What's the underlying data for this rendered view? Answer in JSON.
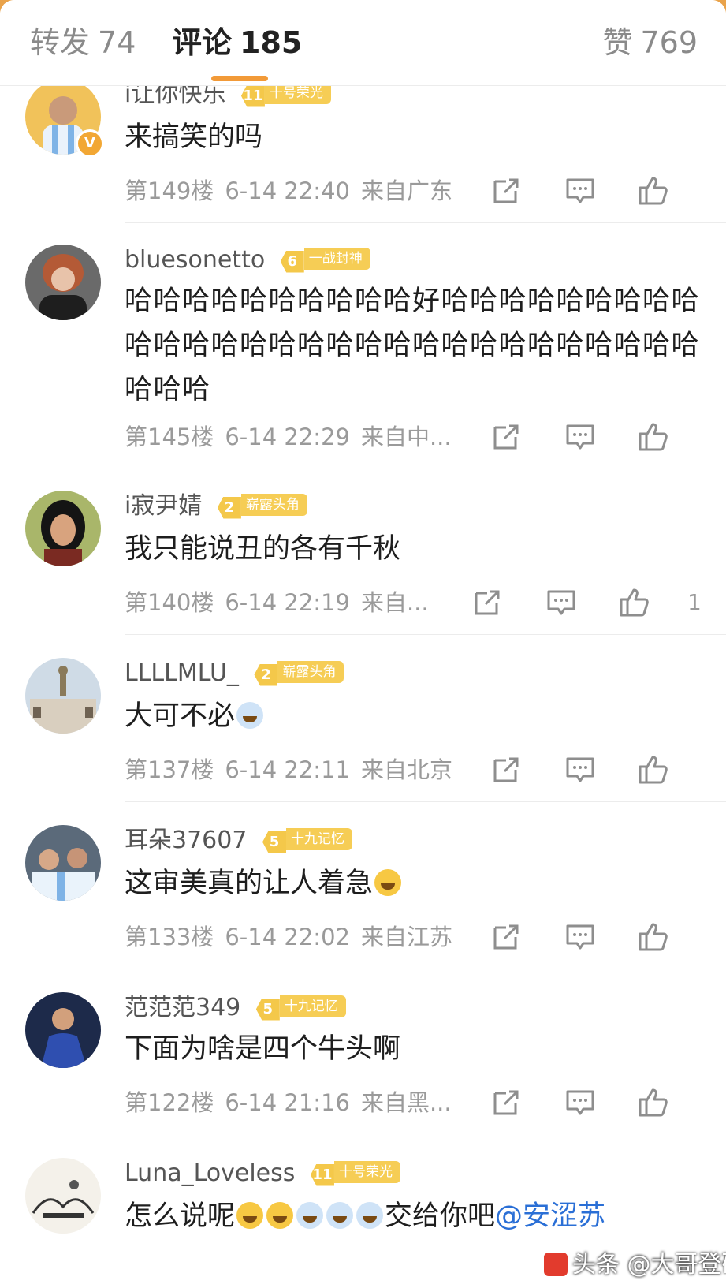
{
  "tabs": {
    "repost": {
      "label": "转发",
      "count": "74"
    },
    "comment": {
      "label": "评论",
      "count": "185"
    },
    "like": {
      "label": "赞",
      "count": "769"
    }
  },
  "comments": [
    {
      "user": "i让你快乐",
      "level": "11",
      "title": "十号荣光",
      "text": "来搞笑的吗",
      "floor": "第149楼",
      "time": "6-14 22:40",
      "location": "来自广东",
      "likes": "",
      "verified": true
    },
    {
      "user": "bluesonetto",
      "level": "6",
      "title": "一战封神",
      "text": "哈哈哈哈哈哈哈哈哈哈好哈哈哈哈哈哈哈哈哈哈哈哈哈哈哈哈哈哈哈哈哈哈哈哈哈哈哈哈哈哈哈哈",
      "floor": "第145楼",
      "time": "6-14 22:29",
      "location": "来自中...",
      "likes": ""
    },
    {
      "user": "i寂尹婧",
      "level": "2",
      "title": "崭露头角",
      "text": "我只能说丑的各有千秋",
      "floor": "第140楼",
      "time": "6-14 22:19",
      "location": "来自...",
      "likes": "1"
    },
    {
      "user": "LLLLMLU_",
      "level": "2",
      "title": "崭露头角",
      "text": "大可不必",
      "floor": "第137楼",
      "time": "6-14 22:11",
      "location": "来自北京",
      "likes": ""
    },
    {
      "user": "耳朵37607",
      "level": "5",
      "title": "十九记忆",
      "text": "这审美真的让人着急",
      "floor": "第133楼",
      "time": "6-14 22:02",
      "location": "来自江苏",
      "likes": ""
    },
    {
      "user": "范范范349",
      "level": "5",
      "title": "十九记忆",
      "text": "下面为啥是四个牛头啊",
      "floor": "第122楼",
      "time": "6-14 21:16",
      "location": "来自黑...",
      "likes": ""
    },
    {
      "user": "Luna_Loveless",
      "level": "11",
      "title": "十号荣光",
      "text": "怎么说呢",
      "text2": "交给你吧",
      "mention": "@安涩苏",
      "floor": "",
      "time": "",
      "location": "",
      "likes": ""
    }
  ],
  "watermark": "头条 @大哥登硬额",
  "colors": {
    "accent": "#f29a38",
    "badge": "#f6cd55",
    "mention": "#2a6fd6"
  }
}
